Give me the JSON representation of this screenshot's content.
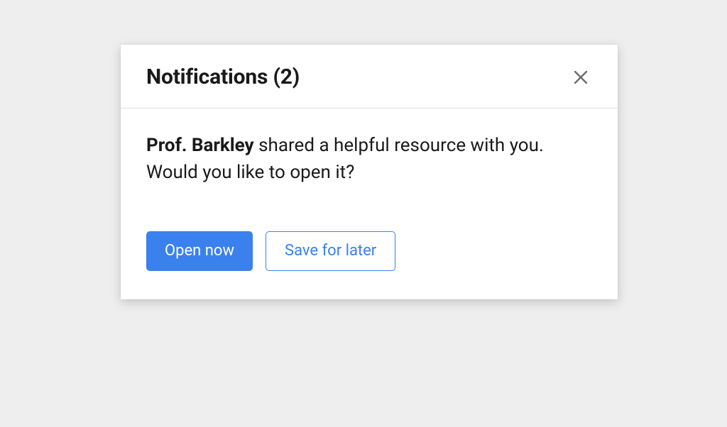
{
  "card": {
    "title": "Notifications (2)",
    "message_bold": "Prof. Barkley",
    "message_rest": " shared a helpful resource with you.  Would you like to open it?",
    "actions": {
      "primary": "Open now",
      "secondary": "Save for later"
    }
  }
}
